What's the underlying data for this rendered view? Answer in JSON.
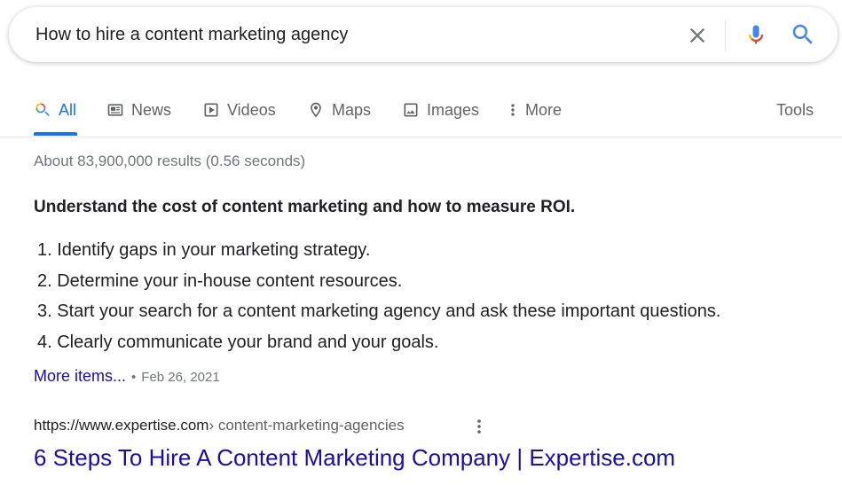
{
  "search": {
    "query": "How to hire a content marketing agency",
    "clear_icon": "close-icon",
    "mic_icon": "microphone-icon",
    "search_icon": "search-icon"
  },
  "tabs": {
    "items": [
      {
        "label": "All",
        "icon": "google-search-icon",
        "active": true
      },
      {
        "label": "News",
        "icon": "news-icon"
      },
      {
        "label": "Videos",
        "icon": "play-icon"
      },
      {
        "label": "Maps",
        "icon": "map-pin-icon"
      },
      {
        "label": "Images",
        "icon": "image-icon"
      },
      {
        "label": "More",
        "icon": "more-vert-icon"
      }
    ],
    "tools": "Tools"
  },
  "stats": "About 83,900,000 results (0.56 seconds)",
  "snippet": {
    "heading": "Understand the cost of content marketing and how to measure ROI.",
    "items": [
      "1. Identify gaps in your marketing strategy.",
      "2. Determine your in-house content resources.",
      "3. Start your search for a content marketing agency and ask these important questions.",
      "4. Clearly communicate your brand and your goals."
    ],
    "more_items": "More items...",
    "separator": "•",
    "date": "Feb 26, 2021"
  },
  "result": {
    "cite_domain": "https://www.expertise.com",
    "cite_path": " › content-marketing-agencies",
    "title": "6 Steps To Hire A Content Marketing Company | Expertise.com"
  },
  "colors": {
    "accent": "#1a73e8",
    "link": "#1a0dab",
    "muted": "#70757a"
  }
}
